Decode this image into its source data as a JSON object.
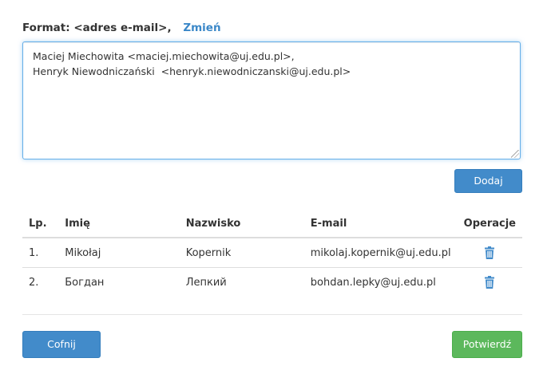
{
  "format": {
    "label": "Format: <adres e-mail>,",
    "change_link": "Zmień"
  },
  "input": {
    "value": "Maciej Miechowita <maciej.miechowita@uj.edu.pl>,\nHenryk Niewodniczański  <henryk.niewodniczanski@uj.edu.pl>"
  },
  "actions": {
    "add_label": "Dodaj",
    "back_label": "Cofnij",
    "confirm_label": "Potwierdź"
  },
  "table": {
    "headers": {
      "lp": "Lp.",
      "first_name": "Imię",
      "last_name": "Nazwisko",
      "email": "E-mail",
      "operations": "Operacje"
    },
    "rows": [
      {
        "lp": "1.",
        "first_name": "Mikołaj",
        "last_name": "Kopernik",
        "email": "mikolaj.kopernik@uj.edu.pl",
        "op_icon": "trash-icon"
      },
      {
        "lp": "2.",
        "first_name": "Богдан",
        "last_name": "Лепкий",
        "email": "bohdan.lepky@uj.edu.pl",
        "op_icon": "trash-icon"
      }
    ]
  },
  "colors": {
    "primary": "#428bca",
    "success": "#5cb85c",
    "link": "#3a87c8",
    "focus_border": "#66afe9"
  }
}
